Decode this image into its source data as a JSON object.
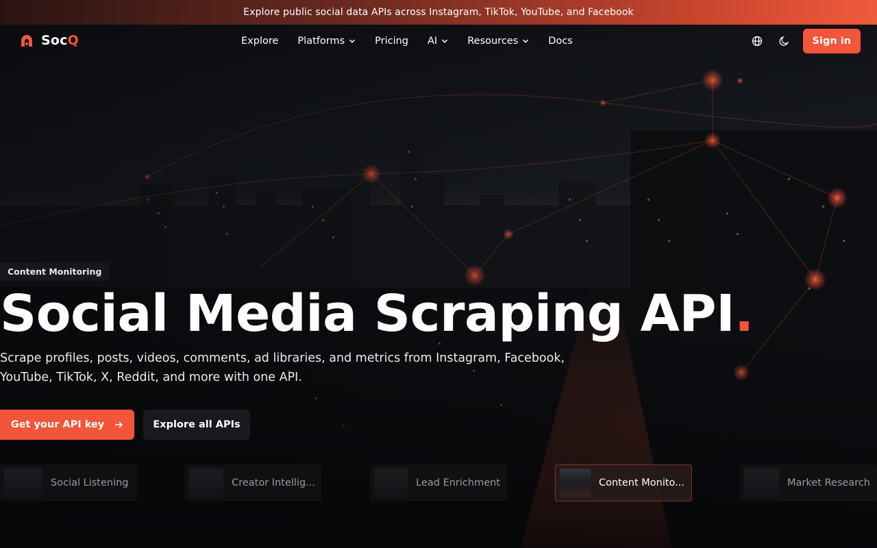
{
  "announcement": {
    "text": "Explore public social data APIs across Instagram, TikTok, YouTube, and Facebook"
  },
  "brand": {
    "name_main": "Soc",
    "name_accent": "Q",
    "accent_color": "#f3553a"
  },
  "nav": {
    "items": [
      {
        "label": "Explore",
        "has_dropdown": false
      },
      {
        "label": "Platforms",
        "has_dropdown": true
      },
      {
        "label": "Pricing",
        "has_dropdown": false
      },
      {
        "label": "AI",
        "has_dropdown": true
      },
      {
        "label": "Resources",
        "has_dropdown": true
      },
      {
        "label": "Docs",
        "has_dropdown": false
      }
    ],
    "icons": [
      "globe-icon",
      "moon-icon"
    ],
    "signin_label": "Sign in"
  },
  "hero": {
    "badge": "Content Monitoring",
    "title": "Social Media Scraping API",
    "title_punct": ".",
    "subtitle": "Scrape profiles, posts, videos, comments, ad libraries, and metrics from Instagram, Facebook, YouTube, TikTok, X, Reddit, and more with one API.",
    "cta_primary": "Get your API key",
    "cta_secondary": "Explore all APIs"
  },
  "use_cases": {
    "items": [
      {
        "label": "Social Listening",
        "active": false
      },
      {
        "label": "Creator Intellig...",
        "active": false
      },
      {
        "label": "Lead Enrichment",
        "active": false
      },
      {
        "label": "Content Monito...",
        "active": true
      },
      {
        "label": "Market Research",
        "active": false
      }
    ]
  }
}
